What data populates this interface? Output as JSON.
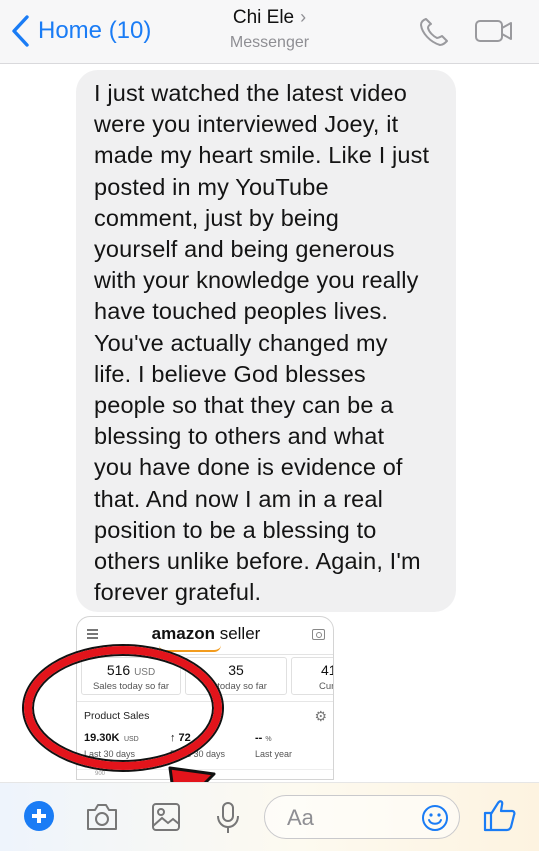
{
  "header": {
    "back_label": "Home (10)",
    "contact_name": "Chi Ele",
    "contact_subtitle": "Messenger",
    "icons": [
      "chevron-left-icon",
      "chevron-right-icon",
      "phone-icon",
      "video-camera-icon"
    ]
  },
  "message": {
    "text": "I just watched the latest video\nwere you interviewed Joey, it\nmade my heart smile. Like I just\nposted in my YouTube\ncomment,  just by being\nyourself and being generous\nwith your knowledge you really\nhave touched peoples lives.\nYou've actually changed my\nlife. I believe God blesses\npeople so that they can be a\nblessing to others and what\nyou have done is evidence of\nthat. And now I am in a real\nposition to be a blessing to\nothers unlike before. Again, I'm\nforever grateful."
  },
  "attachment": {
    "logo_main": "amazon",
    "logo_sub": " seller",
    "cards": [
      {
        "value": "516",
        "unit": "USD",
        "label": "Sales today so far"
      },
      {
        "value": "35",
        "unit": "",
        "label": "its today so far"
      },
      {
        "value": "41",
        "unit": "",
        "label": "Curr"
      }
    ],
    "product_sales_title": "Product Sales",
    "metrics": [
      {
        "value": "19.30K",
        "unit": "USD",
        "label": "Last 30 days"
      },
      {
        "value": "↑ 72",
        "unit": "",
        "label": "Pre   s 30 days"
      },
      {
        "value": "-- ",
        "unit": "%",
        "label": "Last year"
      }
    ],
    "axis_value": "900"
  },
  "composer": {
    "placeholder": "Aa",
    "icons": [
      "plus-icon",
      "camera-icon",
      "gallery-icon",
      "microphone-icon",
      "emoji-icon",
      "thumbs-up-icon"
    ]
  },
  "colors": {
    "accent": "#1a7cf5",
    "annotation_red": "#e3141b",
    "bubble_bg": "#f0f0f1"
  }
}
